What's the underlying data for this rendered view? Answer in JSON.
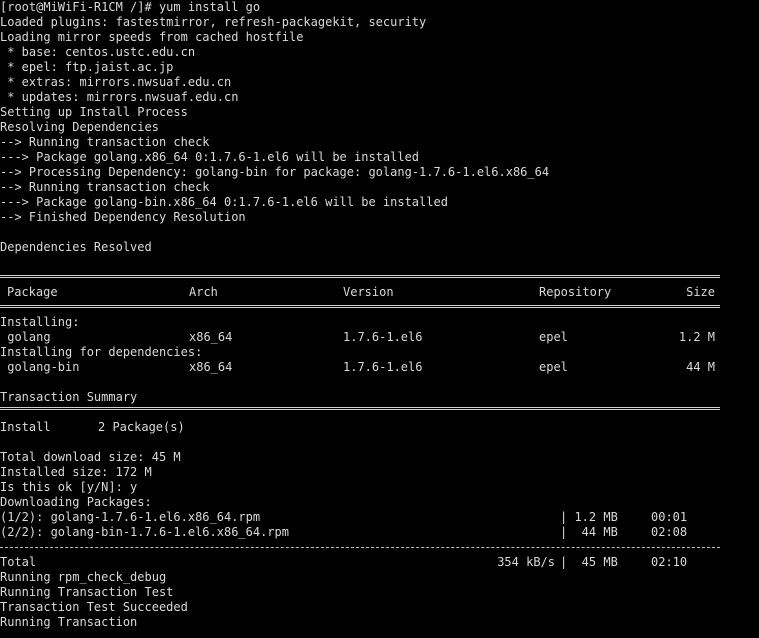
{
  "colors": {
    "background": "#000000",
    "text": "#d9d9d9"
  },
  "lines": {
    "l1": "[root@MiWiFi-R1CM /]# yum install go",
    "l2": "Loaded plugins: fastestmirror, refresh-packagekit, security",
    "l3": "Loading mirror speeds from cached hostfile",
    "l4": " * base: centos.ustc.edu.cn",
    "l5": " * epel: ftp.jaist.ac.jp",
    "l6": " * extras: mirrors.nwsuaf.edu.cn",
    "l7": " * updates: mirrors.nwsuaf.edu.cn",
    "l8": "Setting up Install Process",
    "l9": "Resolving Dependencies",
    "l10": "--> Running transaction check",
    "l11": "---> Package golang.x86_64 0:1.7.6-1.el6 will be installed",
    "l12": "--> Processing Dependency: golang-bin for package: golang-1.7.6-1.el6.x86_64",
    "l13": "--> Running transaction check",
    "l14": "---> Package golang-bin.x86_64 0:1.7.6-1.el6 will be installed",
    "l15": "--> Finished Dependency Resolution",
    "l16": "Dependencies Resolved"
  },
  "table": {
    "headers": {
      "package": "Package",
      "arch": "Arch",
      "version": "Version",
      "repository": "Repository",
      "size": "Size"
    },
    "installing_label": "Installing:",
    "deps_label": "Installing for dependencies:",
    "rows": [
      {
        "package": " golang",
        "arch": "x86_64",
        "version": "1.7.6-1.el6",
        "repository": "epel",
        "size": "1.2 M"
      },
      {
        "package": " golang-bin",
        "arch": "x86_64",
        "version": "1.7.6-1.el6",
        "repository": "epel",
        "size": "44 M"
      }
    ]
  },
  "summary": {
    "title": "Transaction Summary",
    "install_label": "Install",
    "install_count": "2 Package(s)",
    "total_download": "Total download size: 45 M",
    "installed_size": "Installed size: 172 M",
    "prompt": "Is this ok [y/N]: y",
    "downloading": "Downloading Packages:"
  },
  "downloads": [
    {
      "name": "(1/2): golang-1.7.6-1.el6.x86_64.rpm",
      "size": "| 1.2 MB",
      "time": "00:01"
    },
    {
      "name": "(2/2): golang-bin-1.7.6-1.el6.x86_64.rpm",
      "size": "|  44 MB",
      "time": "02:08"
    }
  ],
  "total_row": {
    "label": "Total",
    "speed": "354 kB/s",
    "size": "|  45 MB",
    "time": "02:10"
  },
  "tail": {
    "t1": "Running rpm_check_debug",
    "t2": "Running Transaction Test",
    "t3": "Transaction Test Succeeded",
    "t4": "Running Transaction"
  }
}
